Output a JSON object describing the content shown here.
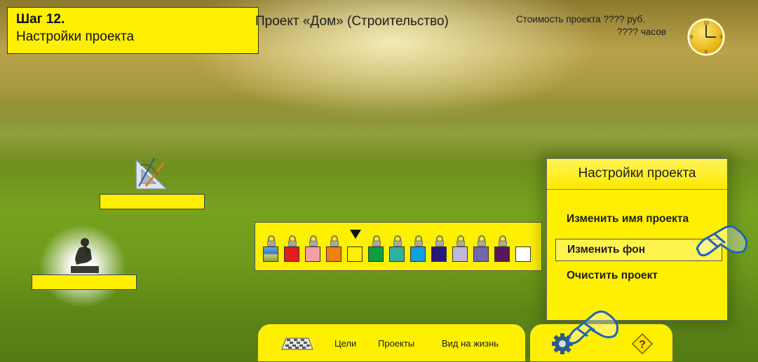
{
  "step": {
    "title": "Шаг 12.",
    "subtitle": "Настройки проекта"
  },
  "project_title": "Проект «Дом» (Строительство)",
  "cost": {
    "line1": "Стоимость проекта ???? руб.",
    "line2": "???? часов"
  },
  "clock": {
    "numerals": [
      "12",
      "3",
      "6",
      "9"
    ]
  },
  "palette": {
    "swatches": [
      {
        "type": "image",
        "color": "#3a7fc0",
        "locked": true
      },
      {
        "color": "#e01e1e",
        "locked": true
      },
      {
        "color": "#f2a0a8",
        "locked": true
      },
      {
        "color": "#f08010",
        "locked": true
      },
      {
        "color": "#ffef00",
        "locked": false,
        "selected": true
      },
      {
        "color": "#0aa040",
        "locked": true
      },
      {
        "color": "#30b0a0",
        "locked": true
      },
      {
        "color": "#10a0e0",
        "locked": true
      },
      {
        "color": "#281878",
        "locked": true
      },
      {
        "color": "#c0b8d8",
        "locked": true
      },
      {
        "color": "#7068b0",
        "locked": true
      },
      {
        "color": "#581858",
        "locked": true
      },
      {
        "color": "#ffffff",
        "locked": false
      }
    ]
  },
  "settings_panel": {
    "header": "Настройки проекта",
    "items": [
      {
        "label": "Изменить имя проекта"
      },
      {
        "label": "Изменить фон"
      },
      {
        "label": "Очистить проект"
      }
    ]
  },
  "bottom_nav": {
    "items": [
      {
        "label": "Цели"
      },
      {
        "label": "Проекты"
      },
      {
        "label": "Вид на жизнь"
      }
    ]
  },
  "colors": {
    "accent": "#ffef00",
    "hand_blue": "#1f62b8"
  }
}
